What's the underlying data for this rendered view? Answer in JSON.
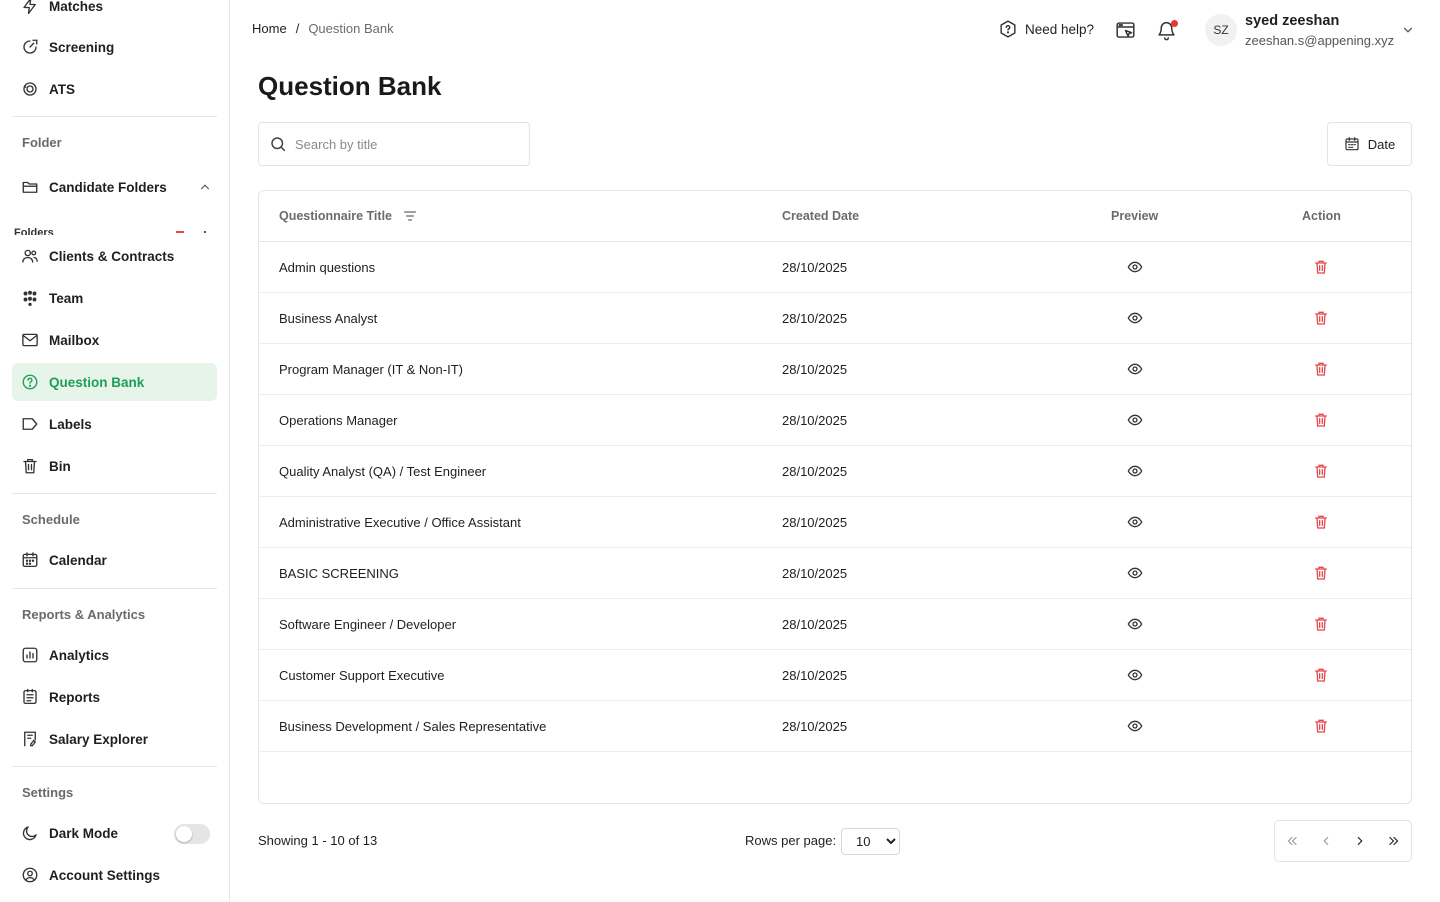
{
  "sidebar": {
    "items": {
      "matches": "Matches",
      "screening": "Screening",
      "ats": "ATS",
      "candidate_folders": "Candidate Folders",
      "folders_sub": "Folders",
      "clients": "Clients & Contracts",
      "team": "Team",
      "mailbox": "Mailbox",
      "question_bank": "Question Bank",
      "labels": "Labels",
      "bin": "Bin",
      "calendar": "Calendar",
      "analytics": "Analytics",
      "reports": "Reports",
      "salary_explorer": "Salary Explorer",
      "dark_mode": "Dark Mode",
      "account_settings": "Account Settings"
    },
    "sections": {
      "folder": "Folder",
      "schedule": "Schedule",
      "reports": "Reports & Analytics",
      "settings": "Settings"
    },
    "dark_mode_on": false,
    "active_color": "#1f9d55"
  },
  "header": {
    "breadcrumb_home": "Home",
    "breadcrumb_sep": "/",
    "breadcrumb_current": "Question Bank",
    "help_label": "Need help?",
    "avatar_initials": "SZ",
    "user_name": "syed zeeshan",
    "user_email": "zeeshan.s@appening.xyz"
  },
  "page": {
    "title": "Question Bank",
    "search_placeholder": "Search by title",
    "date_label": "Date"
  },
  "table": {
    "columns": {
      "title": "Questionnaire Title",
      "created": "Created Date",
      "preview": "Preview",
      "action": "Action"
    },
    "rows": [
      {
        "title": "Admin questions",
        "date": "28/10/2025"
      },
      {
        "title": "Business Analyst",
        "date": "28/10/2025"
      },
      {
        "title": "Program Manager (IT & Non-IT)",
        "date": "28/10/2025"
      },
      {
        "title": "Operations Manager",
        "date": "28/10/2025"
      },
      {
        "title": "Quality Analyst (QA) / Test Engineer",
        "date": "28/10/2025"
      },
      {
        "title": "Administrative Executive / Office Assistant",
        "date": "28/10/2025"
      },
      {
        "title": "BASIC SCREENING",
        "date": "28/10/2025"
      },
      {
        "title": "Software Engineer / Developer",
        "date": "28/10/2025"
      },
      {
        "title": "Customer Support Executive",
        "date": "28/10/2025"
      },
      {
        "title": "Business Development / Sales Representative",
        "date": "28/10/2025"
      }
    ],
    "delete_color": "#e5484d"
  },
  "footer": {
    "showing": "Showing 1 - 10 of 13",
    "rows_per_page_label": "Rows per page:",
    "rows_per_page_value": "10"
  }
}
